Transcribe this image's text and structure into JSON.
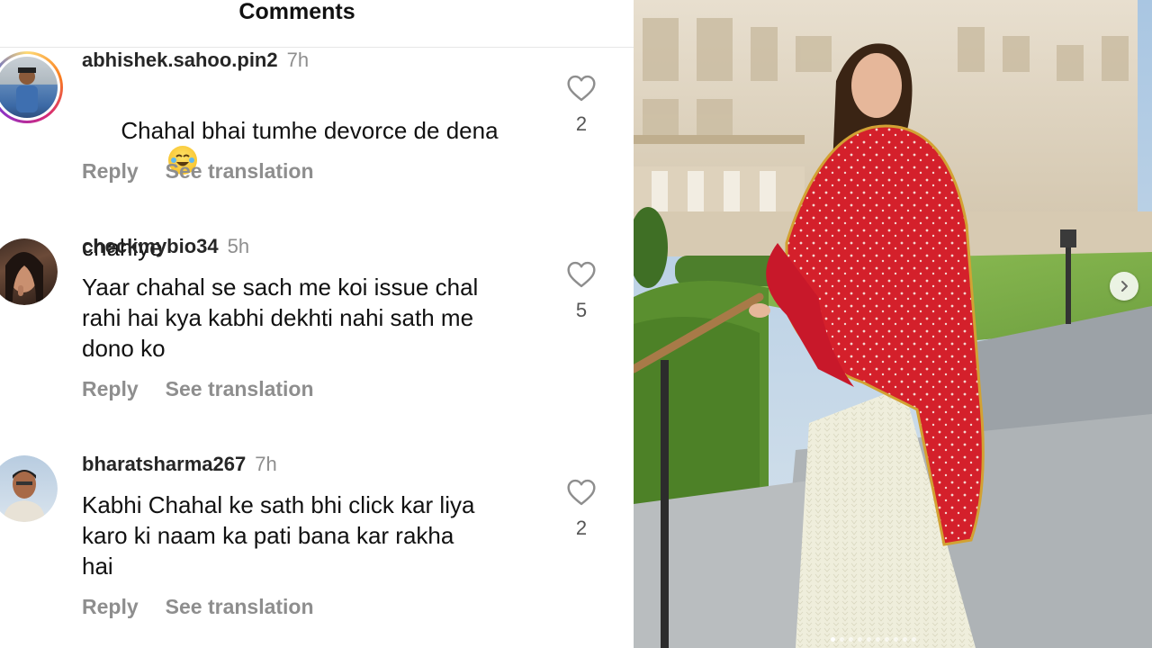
{
  "header": {
    "title": "Comments"
  },
  "comments": [
    {
      "username": "abhishek.sahoo.pin2",
      "time": "7h",
      "text_line": "Chahal bhai tumhe devorce de dena",
      "text_end": "chahiye",
      "emoji": "face-with-tears-of-joy",
      "reply": "Reply",
      "see_translation": "See translation",
      "likes": "2",
      "has_story": true
    },
    {
      "username": "checkmybio34",
      "time": "5h",
      "text": "Yaar chahal se sach me koi issue chal\nrahi hai kya kabhi dekhti nahi sath me\ndono ko",
      "reply": "Reply",
      "see_translation": "See translation",
      "likes": "5",
      "has_story": false
    },
    {
      "username": "bharatsharma267",
      "time": "7h",
      "text": "Kabhi Chahal ke sath bhi click kar liya\nkaro ki naam ka pati bana kar rakha\nhai",
      "reply": "Reply",
      "see_translation": "See translation",
      "likes": "2",
      "has_story": false
    }
  ],
  "icons": {
    "like": "heart-outline-icon",
    "next": "chevron-right-icon"
  },
  "colors": {
    "username": "#262626",
    "meta": "#8e8e8e",
    "dupatta": "#d4202b",
    "skirt": "#efeedc"
  }
}
